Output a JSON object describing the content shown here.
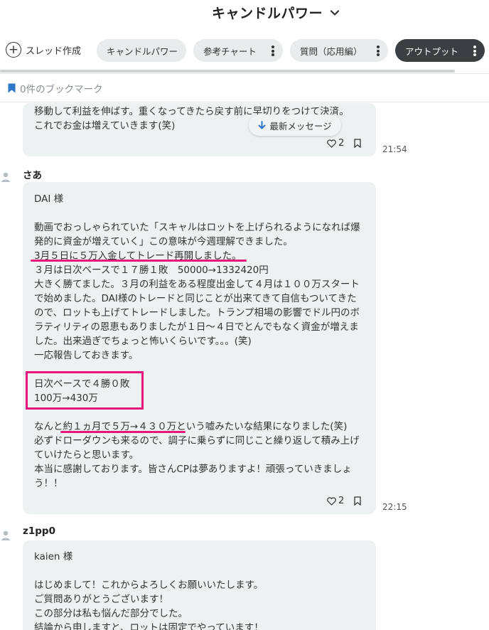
{
  "header": {
    "title": "キャンドルパワー",
    "chevron_icon": "chevron-down-icon"
  },
  "tabs": {
    "new_thread": "スレッド作成",
    "items": [
      {
        "label": "キャンドルパワー"
      },
      {
        "label": "参考チャート"
      },
      {
        "label": "質問（応用編）"
      },
      {
        "label": "アウトプット"
      }
    ]
  },
  "bookmark": {
    "label": "0件のブックマーク",
    "icon": "bookmark-icon"
  },
  "latest_message": {
    "label": "最新メッセージ",
    "icon": "arrow-down-icon"
  },
  "messages": [
    {
      "text": "移動して利益を伸ばす。重くなってきたら戻す前に早切りをつけて決済。\nこれでお金は増えていきます(笑)",
      "likes": "2",
      "time": "21:54"
    },
    {
      "author": "さあ",
      "text": "DAI 様\n\n動画でおっしゃられていた「スキャルはロットを上げられるようになれば爆発的に資金が増えていく」この意味が今週理解できました。\n3月５日に５万入金してトレード再開しました。\n３月は日次ベースで１７勝１敗　50000→1332420円\n大きく勝てました。３月の利益をある程度出金して４月は１００万スタートで始めました。DAI様のトレードと同じことが出来てきて自信もついてきたので、ロットも上げてトレードしました。トランプ相場の影響でドル円のボラティリティの恩恵もありましたが１日〜４日でとんでもなく資金が増えました。出来過ぎでちょっと怖いくらいです。。。(笑)\n一応報告しておきます。\n\n日次ベースで４勝０敗\n100万→430万\n\nなんと約１ヵ月で５万→４３０万という嘘みたいな結果になりました(笑)\n必ずドローダウンも来るので、調子に乗らずに同じこと繰り返して積み上げていけたらと思います。\n本当に感謝しております。皆さんCPは夢ありますよ！頑張っていきましょう！！",
      "likes": "2",
      "time": "22:15"
    },
    {
      "author": "z1pp0",
      "text": "kaien 様\n\nはじめまして！これからよろしくお願いいたします。\nご質問ありがとうございます！\nこの部分は私も悩んだ部分でした。\n結論から申しますと、ロットは固定でやっています！"
    }
  ],
  "colors": {
    "accent_pink": "#e5177a",
    "bubble_bg": "#eef1f2",
    "dark_tab": "#3b3f42"
  }
}
